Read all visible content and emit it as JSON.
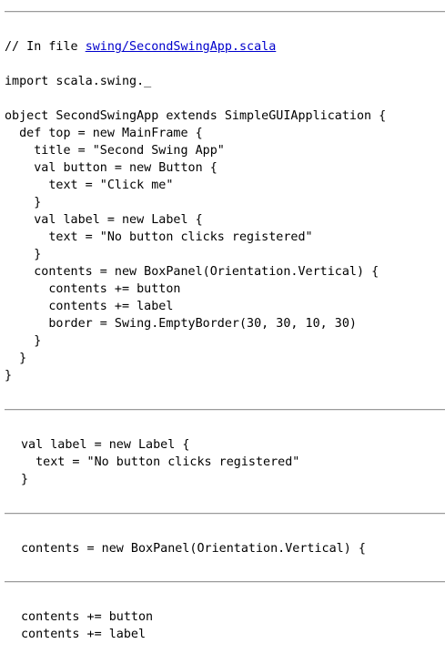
{
  "listing_1": {
    "comment_prefix": "// In file ",
    "file_link": "swing/SecondSwingApp.scala",
    "lines": [
      "",
      "import scala.swing._",
      "",
      "object SecondSwingApp extends SimpleGUIApplication {",
      "  def top = new MainFrame {",
      "    title = \"Second Swing App\"",
      "    val button = new Button {",
      "      text = \"Click me\"",
      "    }",
      "    val label = new Label {",
      "      text = \"No button clicks registered\"",
      "    }",
      "    contents = new BoxPanel(Orientation.Vertical) {",
      "      contents += button",
      "      contents += label",
      "      border = Swing.EmptyBorder(30, 30, 10, 30)",
      "    }",
      "  }",
      "}"
    ]
  },
  "listing_2": {
    "lines": [
      "val label = new Label {",
      "  text = \"No button clicks registered\"",
      "}"
    ]
  },
  "listing_3": {
    "lines": [
      "contents = new BoxPanel(Orientation.Vertical) {"
    ]
  },
  "listing_4": {
    "lines": [
      "contents += button",
      "contents += label"
    ]
  }
}
